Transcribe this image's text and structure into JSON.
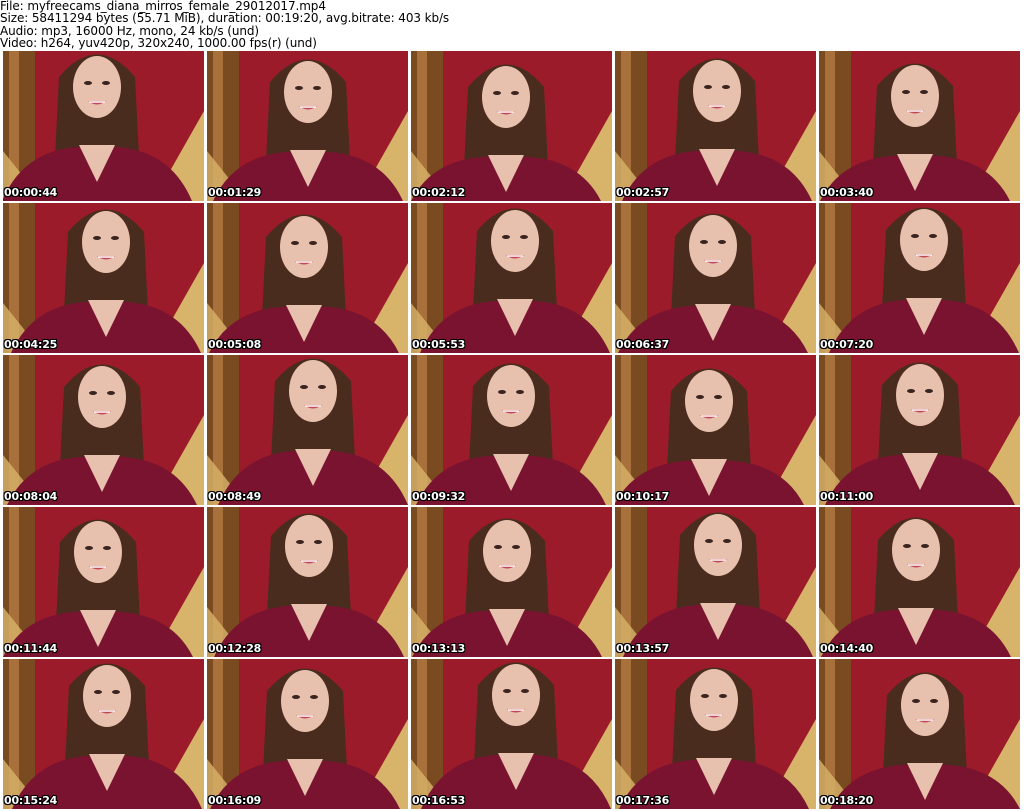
{
  "info": {
    "file": "File: myfreecams_diana_mirros_female_29012017.mp4",
    "size": "Size: 58411294 bytes (55.71 MiB), duration: 00:19:20, avg.bitrate: 403 kb/s",
    "audio": "Audio: mp3, 16000 Hz, mono, 24 kb/s (und)",
    "video": "Video: h264, yuv420p, 320x240, 1000.00 fps(r) (und)"
  },
  "thumbnails": [
    "00:00:44",
    "00:01:29",
    "00:02:12",
    "00:02:57",
    "00:03:40",
    "00:04:25",
    "00:05:08",
    "00:05:53",
    "00:06:37",
    "00:07:20",
    "00:08:04",
    "00:08:49",
    "00:09:32",
    "00:10:17",
    "00:11:00",
    "00:11:44",
    "00:12:28",
    "00:13:13",
    "00:13:57",
    "00:14:40",
    "00:15:24",
    "00:16:09",
    "00:16:53",
    "00:17:36",
    "00:18:20"
  ],
  "colors": {
    "wall": "#9b1b2a",
    "curtain": "#d8b46a",
    "sweater": "#7a1330",
    "hair": "#4a2c1e",
    "skin": "#e8c0ae"
  }
}
